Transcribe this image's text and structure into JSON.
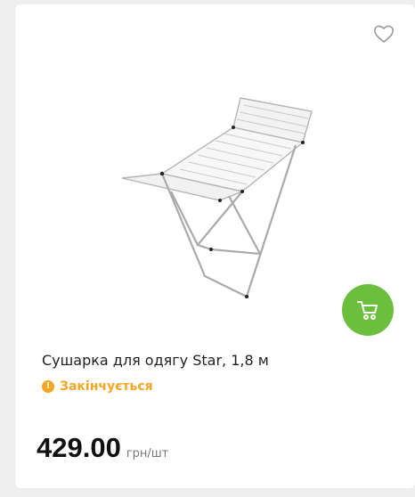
{
  "product": {
    "title": "Сушарка для одягу Star, 1,8 м",
    "status_text": "Закінчується",
    "status_icon": "exclamation-icon",
    "price": "429.00",
    "unit": "грн/шт"
  },
  "icons": {
    "favorite": "heart-outline-icon",
    "cart": "cart-icon"
  },
  "colors": {
    "accent_green": "#6bbf3d",
    "status_orange": "#f5a623",
    "background": "#eeeeee",
    "card": "#ffffff"
  }
}
